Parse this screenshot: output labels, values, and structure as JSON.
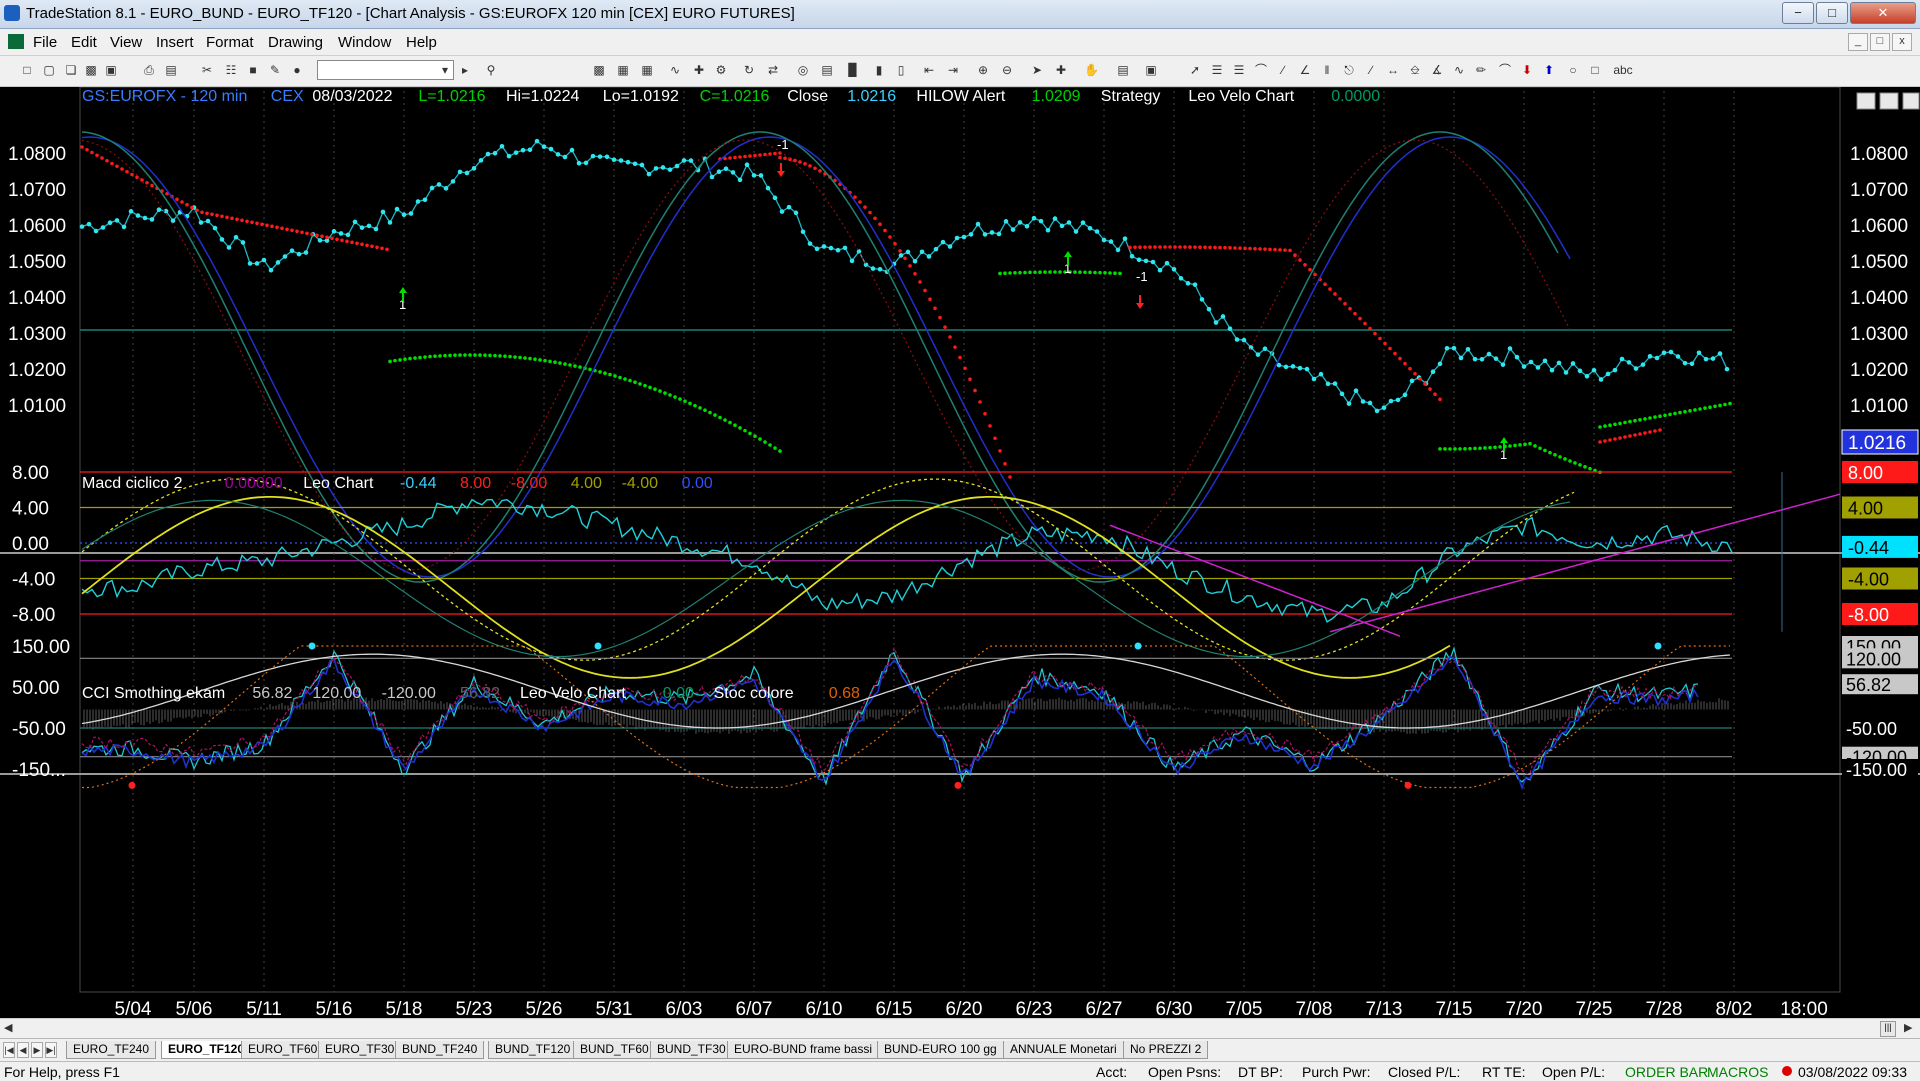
{
  "window": {
    "title": "TradeStation 8.1 - EURO_BUND - EURO_TF120 - [Chart Analysis - GS:EUROFX  120 min  [CEX] EURO FUTURES]",
    "minimize": "−",
    "maximize": "□",
    "close": "✕"
  },
  "menu": [
    "File",
    "Edit",
    "View",
    "Insert",
    "Format",
    "Drawing",
    "Window",
    "Help"
  ],
  "toolbar": {
    "icons": [
      "new-icon",
      "open-icon",
      "copy-icon",
      "save-icon",
      "print-icon",
      "print-preview-icon",
      "cut-icon",
      "paste-icon",
      "lock-icon",
      "chart-icon",
      "globe-icon",
      "format-icon",
      "bar-chart-icon",
      "table-icon",
      "zoom-in-icon",
      "zoom-out-icon",
      "pointer-icon",
      "crosshair-icon",
      "hand-icon",
      "line-icon",
      "trendline-icon",
      "ellipse-icon",
      "text-icon"
    ],
    "symbol_value": ""
  },
  "price_panel": {
    "header": [
      {
        "text": "GS:EUROFX - 120 min",
        "color": "#3a7cff"
      },
      {
        "text": "CEX",
        "color": "#3a7cff"
      },
      {
        "text": "08/03/2022",
        "color": "#ffffff"
      },
      {
        "text": "L=1.0216",
        "color": "#00d000"
      },
      {
        "text": "Hi=1.0224",
        "color": "#ffffff"
      },
      {
        "text": "Lo=1.0192",
        "color": "#ffffff"
      },
      {
        "text": "C=1.0216",
        "color": "#00d000"
      },
      {
        "text": "Close",
        "color": "#ffffff"
      },
      {
        "text": "1.0216",
        "color": "#3ad0ff"
      },
      {
        "text": "HILOW Alert",
        "color": "#ffffff"
      },
      {
        "text": "1.0209",
        "color": "#00d000"
      },
      {
        "text": "Strategy",
        "color": "#ffffff"
      },
      {
        "text": "Leo Velo Chart",
        "color": "#ffffff"
      },
      {
        "text": "0.0000",
        "color": "#009a60"
      }
    ],
    "y_ticks": [
      "1.0800",
      "1.0700",
      "1.0600",
      "1.0500",
      "1.0400",
      "1.0300",
      "1.0200",
      "1.0100"
    ],
    "last_price": "1.0216",
    "signal_labels": [
      "1",
      "-1",
      "1",
      "-1",
      "1"
    ]
  },
  "macd_panel": {
    "header": [
      {
        "text": "Macd ciclico 2",
        "color": "#ffffff"
      },
      {
        "text": "0.00000",
        "color": "#a000a0"
      },
      {
        "text": "Leo Chart",
        "color": "#ffffff"
      },
      {
        "text": "-0.44",
        "color": "#3ad0ff"
      },
      {
        "text": "8.00",
        "color": "#ff2020"
      },
      {
        "text": "-8.00",
        "color": "#ff2020"
      },
      {
        "text": "4.00",
        "color": "#a0a000"
      },
      {
        "text": "-4.00",
        "color": "#a0a000"
      },
      {
        "text": "0.00",
        "color": "#3050ff"
      }
    ],
    "y_ticks": [
      "8.00",
      "4.00",
      "0.00",
      "-4.00",
      "-8.00"
    ],
    "right_labels": [
      {
        "text": "8.00",
        "bg": "#ff1a1a",
        "fg": "#ffffff"
      },
      {
        "text": "4.00",
        "bg": "#a0a000",
        "fg": "#000000"
      },
      {
        "text": "-0.44",
        "bg": "#00e0ff",
        "fg": "#000000"
      },
      {
        "text": "-4.00",
        "bg": "#a0a000",
        "fg": "#000000"
      },
      {
        "text": "-8.00",
        "bg": "#ff1a1a",
        "fg": "#ffffff"
      }
    ]
  },
  "cci_panel": {
    "header": [
      {
        "text": "CCI Smothing ekam",
        "color": "#ffffff"
      },
      {
        "text": "56.82",
        "color": "#c8c8c8"
      },
      {
        "text": "120.00",
        "color": "#c8c8c8"
      },
      {
        "text": "-120.00",
        "color": "#c8c8c8"
      },
      {
        "text": "56.82",
        "color": "#606060"
      },
      {
        "text": "Leo Velo Chart",
        "color": "#ffffff"
      },
      {
        "text": "0.00",
        "color": "#009a60"
      },
      {
        "text": "Stoc colore",
        "color": "#ffffff"
      },
      {
        "text": "0.68",
        "color": "#e06000"
      }
    ],
    "y_ticks": [
      "150.00",
      "50.00",
      "-50.00",
      "-150..."
    ],
    "right_labels": [
      {
        "text": "150.00",
        "bg": "#c8c8c8",
        "fg": "#000000"
      },
      {
        "text": "120.00",
        "bg": "#c8c8c8",
        "fg": "#000000"
      },
      {
        "text": "56.82",
        "bg": "#c8c8c8",
        "fg": "#000000"
      },
      {
        "text": "-50.00",
        "bg": "#000000",
        "fg": "#ffffff"
      },
      {
        "text": "-120.00",
        "bg": "#c8c8c8",
        "fg": "#000000"
      },
      {
        "text": "-150.00",
        "bg": "#000000",
        "fg": "#ffffff"
      }
    ]
  },
  "x_axis": [
    "5/04",
    "5/06",
    "5/11",
    "5/16",
    "5/18",
    "5/23",
    "5/26",
    "5/31",
    "6/03",
    "6/07",
    "6/10",
    "6/15",
    "6/20",
    "6/23",
    "6/27",
    "6/30",
    "7/05",
    "7/08",
    "7/13",
    "7/15",
    "7/20",
    "7/25",
    "7/28",
    "8/02",
    "18:00"
  ],
  "tabs": [
    "EURO_TF240",
    "EURO_TF120",
    "EURO_TF60",
    "EURO_TF30",
    "BUND_TF240",
    "BUND_TF120",
    "BUND_TF60",
    "BUND_TF30",
    "EURO-BUND frame bassi",
    "BUND-EURO 100 gg",
    "ANNUALE Monetari",
    "No PREZZI 2"
  ],
  "active_tab": "EURO_TF120",
  "status": {
    "help": "For Help, press F1",
    "acct": "Acct:",
    "open_psns": "Open Psns:",
    "dt_bp": "DT BP:",
    "purch_pwr": "Purch Pwr:",
    "closed_pl": "Closed P/L:",
    "rt_te": "RT TE:",
    "open_pl": "Open P/L:",
    "order_bar": "ORDER BAR",
    "macros": "MACROS",
    "datetime": "03/08/2022 09:33"
  },
  "colors": {
    "price_dots": "#2ee8f0",
    "up_dots": "#00e000",
    "down_dots": "#ff1a1a",
    "blue_line": "#2030d0",
    "teal_line": "#208070",
    "yellow_line": "#e0e020",
    "magenta_line": "#d020d0",
    "orange_line": "#e07010"
  },
  "chart_data": [
    {
      "type": "line",
      "title": "GS:EUROFX - 120 min",
      "ylim": [
        1.0,
        1.086
      ],
      "x": [
        "5/04",
        "5/06",
        "5/11",
        "5/16",
        "5/18",
        "5/23",
        "5/26",
        "5/31",
        "6/03",
        "6/07",
        "6/10",
        "6/15",
        "6/20",
        "6/23",
        "6/27",
        "6/30",
        "7/05",
        "7/08",
        "7/13",
        "7/15",
        "7/20",
        "7/25",
        "7/28",
        "8/02"
      ],
      "series": [
        {
          "name": "Close",
          "values": [
            1.062,
            1.064,
            1.048,
            1.058,
            1.063,
            1.078,
            1.082,
            1.076,
            1.077,
            1.074,
            1.053,
            1.049,
            1.058,
            1.062,
            1.057,
            1.048,
            1.026,
            1.017,
            1.008,
            1.025,
            1.023,
            1.018,
            1.025,
            1.0216
          ]
        }
      ]
    },
    {
      "type": "line",
      "title": "Macd ciclico 2",
      "ylim": [
        -9,
        9
      ],
      "x": [
        "5/04",
        "5/06",
        "5/11",
        "5/16",
        "5/18",
        "5/23",
        "5/26",
        "5/31",
        "6/03",
        "6/07",
        "6/10",
        "6/15",
        "6/20",
        "6/23",
        "6/27",
        "6/30",
        "7/05",
        "7/08",
        "7/13",
        "7/15",
        "7/20",
        "7/25",
        "7/28",
        "8/02"
      ],
      "series": [
        {
          "values": [
            -5,
            -3,
            -2,
            0,
            2,
            5,
            4,
            2,
            0,
            -2,
            -7,
            -6,
            -2,
            1,
            1,
            -3,
            -6,
            -8,
            -7,
            -1,
            2,
            0,
            1,
            -0.44
          ]
        }
      ]
    },
    {
      "type": "line",
      "title": "CCI Smothing ekam",
      "ylim": [
        -200,
        170
      ],
      "x": [
        "5/04",
        "5/06",
        "5/11",
        "5/16",
        "5/18",
        "5/23",
        "5/26",
        "5/31",
        "6/03",
        "6/07",
        "6/10",
        "6/15",
        "6/20",
        "6/23",
        "6/27",
        "6/30",
        "7/05",
        "7/08",
        "7/13",
        "7/15",
        "7/20",
        "7/25",
        "7/28",
        "8/02"
      ],
      "series": [
        {
          "values": [
            -100,
            -130,
            -90,
            130,
            -150,
            60,
            -40,
            40,
            20,
            80,
            -180,
            140,
            -170,
            80,
            40,
            -150,
            -60,
            -140,
            -20,
            140,
            -190,
            40,
            30,
            56.82
          ]
        }
      ]
    }
  ]
}
